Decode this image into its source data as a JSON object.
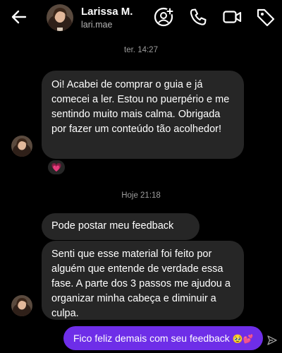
{
  "header": {
    "name": "Larissa M.",
    "username": "lari.mae",
    "icons": [
      "back-arrow-icon",
      "add-people-icon",
      "phone-call-icon",
      "video-call-icon",
      "tag-icon"
    ]
  },
  "conversation": {
    "timestamp_1": "ter. 14:27",
    "message_1": "Oi! Acabei de comprar o guia e já comecei a ler. Estou no puerpério e me sentindo muito mais calma. Obrigada por fazer um conteúdo tão acolhedor!",
    "reaction_1": "💗",
    "timestamp_2": "Hoje 21:18",
    "message_2": "Pode postar meu feedback",
    "message_3": "Senti que esse material foi feito por alguém que entende de verdade essa fase. A parte dos 3 passos me ajudou a organizar minha cabeça e diminuir a culpa.",
    "sent_message": "Fico feliz demais com seu feedback",
    "sent_emoji": "🥹💕"
  },
  "colors": {
    "background": "#000000",
    "received_bubble": "#262626",
    "sent_bubble": "#6e2ee8",
    "timestamp": "#9c9c9c"
  }
}
